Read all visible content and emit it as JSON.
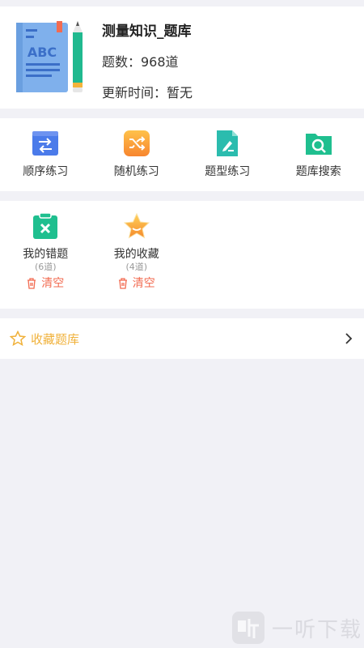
{
  "bank": {
    "title": "测量知识_题库",
    "count_text": "题数：968道",
    "update_text": "更新时间：暂无"
  },
  "practice": [
    {
      "label": "顺序练习",
      "icon": "sequence-icon"
    },
    {
      "label": "随机练习",
      "icon": "shuffle-icon"
    },
    {
      "label": "题型练习",
      "icon": "question-type-icon"
    },
    {
      "label": "题库搜索",
      "icon": "search-folder-icon"
    }
  ],
  "mine": {
    "wrong": {
      "label": "我的错题",
      "count": "(6道)",
      "clear": "清空"
    },
    "fav": {
      "label": "我的收藏",
      "count": "(4道)",
      "clear": "清空"
    }
  },
  "collect_bank": {
    "label": "收藏题库"
  },
  "watermark": {
    "text": "一听下载"
  },
  "colors": {
    "accent_orange": "#f0b13a",
    "clear_red": "#f26b51",
    "blue": "#4b7bea",
    "teal": "#2bbcae",
    "green": "#1fbf8f"
  }
}
